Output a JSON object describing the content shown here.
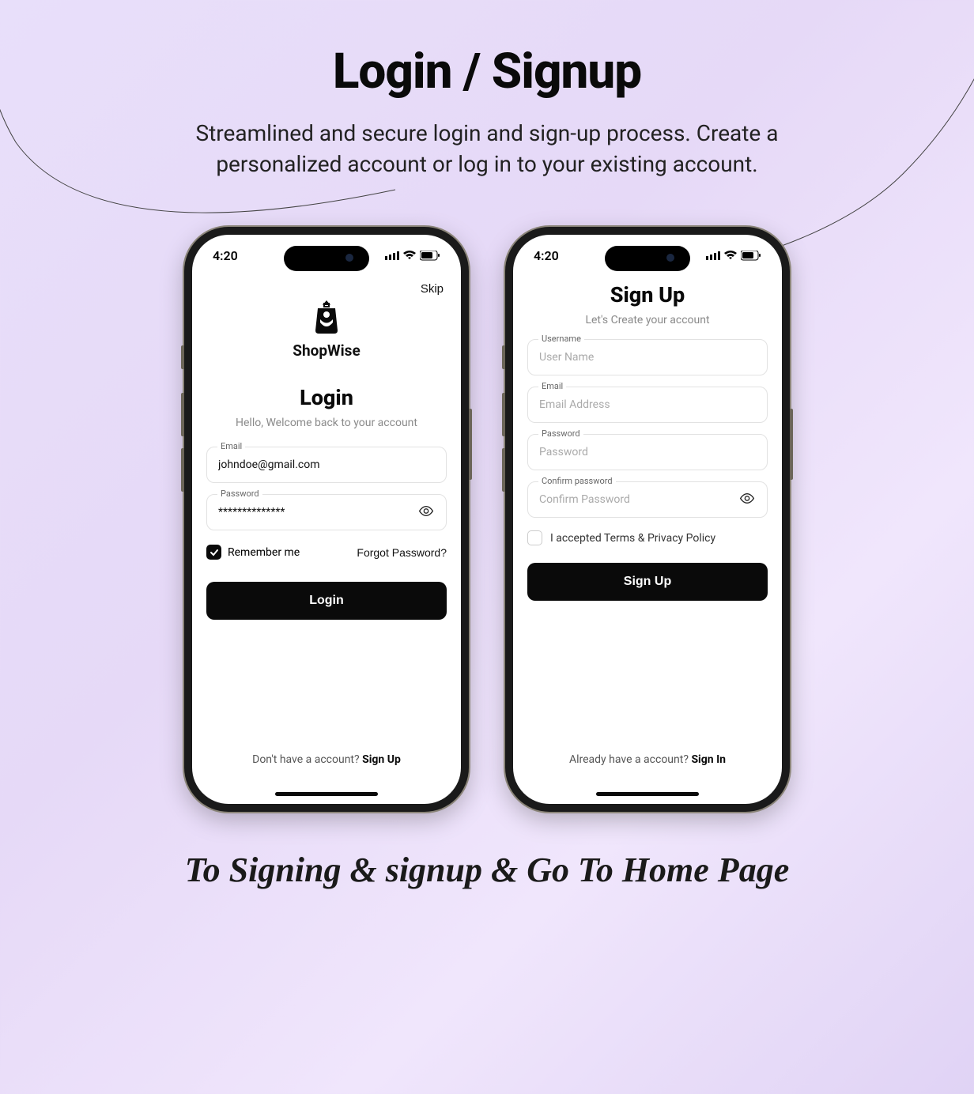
{
  "page": {
    "title": "Login / Signup",
    "subtitle": "Streamlined and secure login and sign-up process. Create a personalized account or log in to your existing account.",
    "bottom_caption": "To Signing & signup & Go To Home Page"
  },
  "status": {
    "time": "4:20"
  },
  "login": {
    "skip": "Skip",
    "brand": "ShopWise",
    "title": "Login",
    "subtitle": "Hello, Welcome back to your account",
    "email_label": "Email",
    "email_value": "johndoe@gmail.com",
    "password_label": "Password",
    "password_value": "**************",
    "remember_label": "Remember me",
    "forgot_label": "Forgot Password?",
    "button": "Login",
    "footer_prefix": "Don't have a account? ",
    "footer_link": "Sign Up"
  },
  "signup": {
    "title": "Sign Up",
    "subtitle": "Let's Create your account",
    "username_label": "Username",
    "username_placeholder": "User Name",
    "email_label": "Email",
    "email_placeholder": "Email Address",
    "password_label": "Password",
    "password_placeholder": "Password",
    "confirm_label": "Confirm password",
    "confirm_placeholder": "Confirm Password",
    "terms_label": "I accepted Terms & Privacy Policy",
    "button": "Sign Up",
    "footer_prefix": "Already have a account? ",
    "footer_link": "Sign In"
  }
}
